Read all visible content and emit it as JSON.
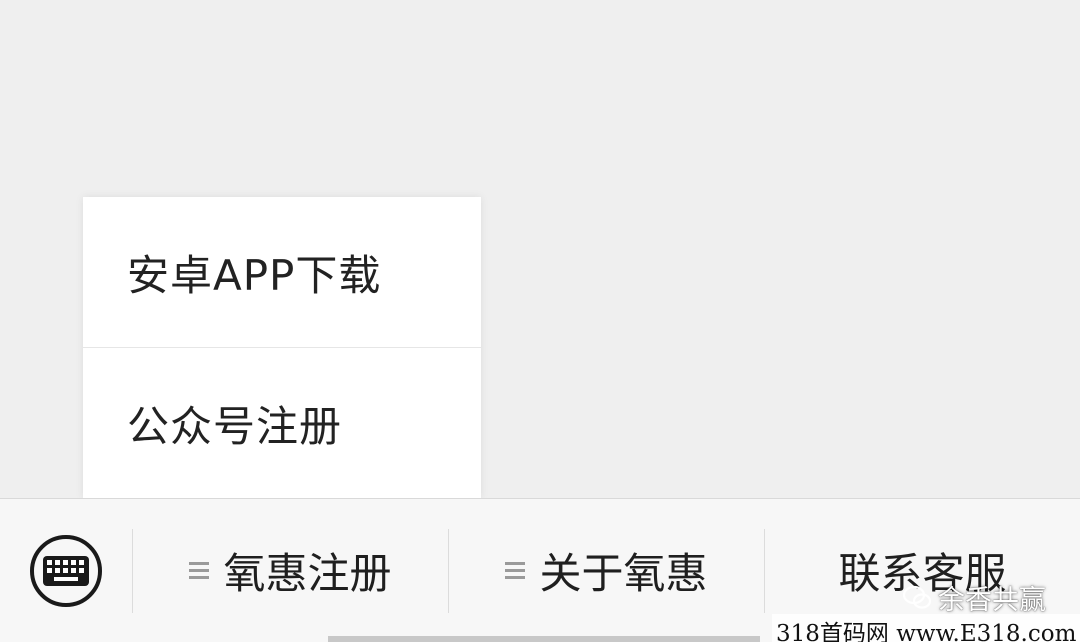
{
  "popup_menu": {
    "items": [
      {
        "label": "安卓APP下载"
      },
      {
        "label": "公众号注册"
      }
    ]
  },
  "menu_bar": {
    "keyboard_icon": "keyboard-icon",
    "items": [
      {
        "label": "氧惠注册",
        "icon": "list-icon"
      },
      {
        "label": "关于氧惠",
        "icon": "list-icon"
      },
      {
        "label": "联系客服"
      }
    ]
  },
  "watermark": {
    "brand": "余香共赢",
    "footer": "318首码网 www.E318.com"
  },
  "colors": {
    "background": "#efefef",
    "popup_bg": "#ffffff",
    "menubar_bg": "#f7f7f7",
    "text": "#222222",
    "icon": "#9a9a9a"
  }
}
